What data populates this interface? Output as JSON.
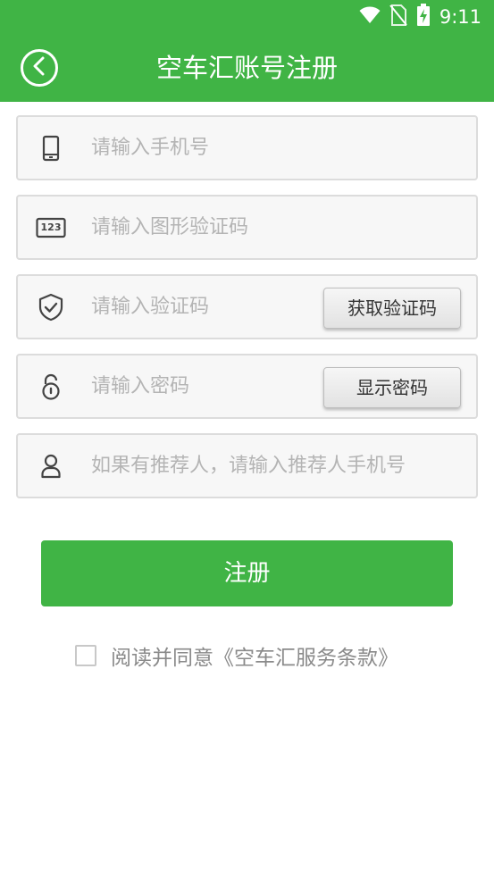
{
  "status_bar": {
    "time": "9:11",
    "icons": [
      "wifi-icon",
      "no-sim-icon",
      "battery-charging-icon"
    ]
  },
  "header": {
    "title": "空车汇账号注册",
    "back_icon": "chevron-left-icon",
    "background": "#40b445"
  },
  "form": {
    "phone": {
      "placeholder": "请输入手机号",
      "icon": "phone-icon"
    },
    "captcha": {
      "placeholder": "请输入图形验证码",
      "icon": "captcha-123-icon",
      "captcha_glyph": "123"
    },
    "sms_code": {
      "placeholder": "请输入验证码",
      "icon": "shield-check-icon",
      "button_label": "获取验证码"
    },
    "password": {
      "placeholder": "请输入密码",
      "icon": "lock-icon",
      "button_label": "显示密码"
    },
    "referrer": {
      "placeholder": "如果有推荐人，请输入推荐人手机号",
      "icon": "user-icon"
    }
  },
  "register": {
    "label": "注册"
  },
  "agreement": {
    "text": "阅读并同意《空车汇服务条款》",
    "checked": false
  },
  "colors": {
    "accent": "#40b445",
    "field_bg": "#f7f7f7",
    "field_border": "#dcdcdc",
    "placeholder": "#b4b4b4"
  }
}
